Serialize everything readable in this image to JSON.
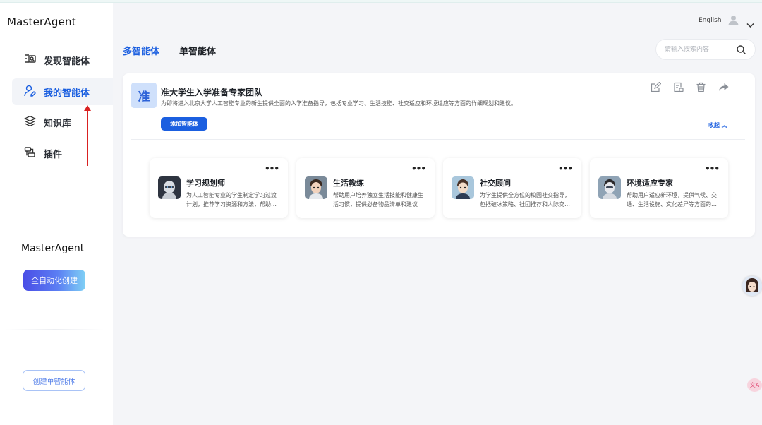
{
  "app": {
    "logo": "MasterAgent"
  },
  "sidebar": {
    "items": [
      {
        "label": "发现智能体",
        "icon": "discover-icon"
      },
      {
        "label": "我的智能体",
        "icon": "user-agent-icon"
      },
      {
        "label": "知识库",
        "icon": "layers-icon"
      },
      {
        "label": "插件",
        "icon": "plugin-icon"
      }
    ],
    "active_index": 1,
    "brand": "MasterAgent",
    "auto_create_label": "全自动化创建",
    "create_single_label": "创建单智能体"
  },
  "header": {
    "language": "English",
    "tabs": [
      {
        "label": "多智能体",
        "active": true
      },
      {
        "label": "单智能体",
        "active": false
      }
    ],
    "search_placeholder": "请输入搜索内容"
  },
  "team": {
    "avatar_char": "准",
    "name": "准大学生入学准备专家团队",
    "description": "为即将进入北京大学人工智能专业的新生提供全面的入学准备指导，包括专业学习、生活技能、社交适应和环境适应等方面的详细规划和建议。",
    "add_label": "添加智能体",
    "collapse_label": "收起",
    "actions": [
      "edit-icon",
      "report-icon",
      "delete-icon",
      "share-icon"
    ],
    "agents": [
      {
        "name": "学习规划师",
        "desc": "为人工智能专业的学生制定学习过渡计划，推荐学习资源和方法，帮助学生顺利过渡",
        "more": "•••"
      },
      {
        "name": "生活教练",
        "desc": "帮助用户培养独立生活技能和健康生活习惯，提供必备物品清单和建议",
        "more": "•••"
      },
      {
        "name": "社交顾问",
        "desc": "为学生提供全方位的校园社交指导，包括破冰策略、社团推荐和人际交往建议",
        "more": "•••"
      },
      {
        "name": "环境适应专家",
        "desc": "帮助用户适应新环境，提供气候、交通、生活设施、文化差异等方面的指导",
        "more": "•••"
      }
    ]
  },
  "floating": {
    "translate_label": "文A"
  },
  "colors": {
    "accent": "#1b5fe0",
    "annotation_arrow": "#d92121"
  }
}
